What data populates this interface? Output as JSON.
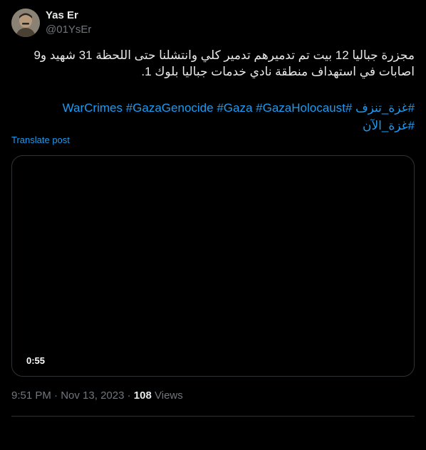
{
  "author": {
    "name": "Yas Er",
    "handle": "@01YsEr"
  },
  "tweet": {
    "text_line_1": "مجزرة جباليا  12 بيت تم تدميرهم تدمير كلي وانتشلنا حتى اللحظة 31 شهيد و9",
    "text_line_2": "اصابات في استهداف منطقة نادي خدمات جباليا بلوك 1."
  },
  "hashtags": [
    "#غزة_تنزف",
    "#WarCrimes",
    "#GazaGenocide",
    "#Gaza",
    "#GazaHolocaust",
    "#غزة_الآن"
  ],
  "translate_label": "Translate post",
  "video": {
    "duration": "0:55"
  },
  "meta": {
    "time": "9:51 PM",
    "date": "Nov 13, 2023",
    "separator": "·",
    "views_count": "108",
    "views_label": "Views"
  },
  "colors": {
    "background": "#000000",
    "text": "#e7e9ea",
    "muted": "#71767b",
    "accent": "#1d9bf0",
    "border": "#2f3336"
  }
}
